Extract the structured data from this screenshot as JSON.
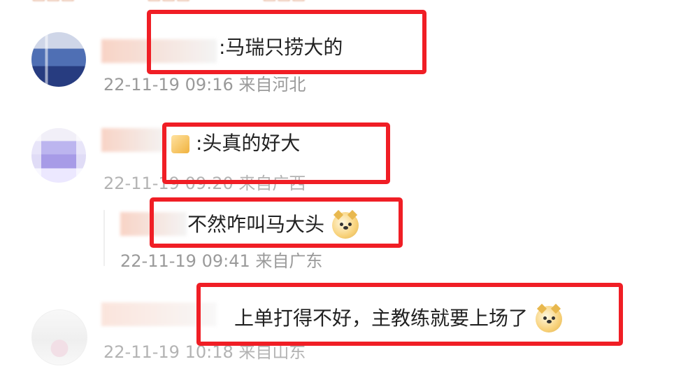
{
  "comments": [
    {
      "content": ":马瑞只捞大的",
      "meta": "22-11-19 09:16 来自河北"
    },
    {
      "content": ":头真的好大",
      "meta": "22-11-19 09:20 来自广西"
    },
    {
      "content": "不然咋叫马大头",
      "meta": "22-11-19 09:41 来自广东"
    },
    {
      "content": "上单打得不好，主教练就要上场了",
      "meta": "22-11-19 10:18 来自山东"
    }
  ],
  "colors": {
    "highlight": "#f01e25",
    "meta": "#9a9a9a",
    "accent": "#cc6a35"
  },
  "icons": [
    "dog-emoji-icon",
    "sticker-icon"
  ]
}
